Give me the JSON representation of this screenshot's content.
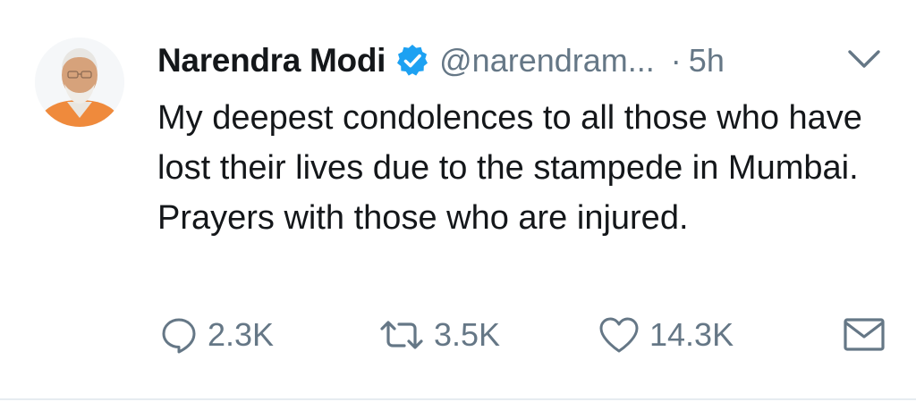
{
  "tweet": {
    "author_name": "Narendra Modi",
    "handle": "@narendram...",
    "separator": "·",
    "time": "5h",
    "text": "My deepest condolences to all those who have lost their lives due to the stampede in Mumbai. Prayers with those who are injured.",
    "verified": true
  },
  "actions": {
    "reply_count": "2.3K",
    "retweet_count": "3.5K",
    "like_count": "14.3K"
  },
  "icons": {
    "verified": "verified-badge-icon",
    "menu": "chevron-down-icon",
    "reply": "reply-icon",
    "retweet": "retweet-icon",
    "like": "heart-icon",
    "dm": "envelope-icon"
  },
  "colors": {
    "text": "#14171a",
    "secondary": "#657786",
    "verified": "#1da1f2",
    "divider": "#e6ecf0"
  }
}
